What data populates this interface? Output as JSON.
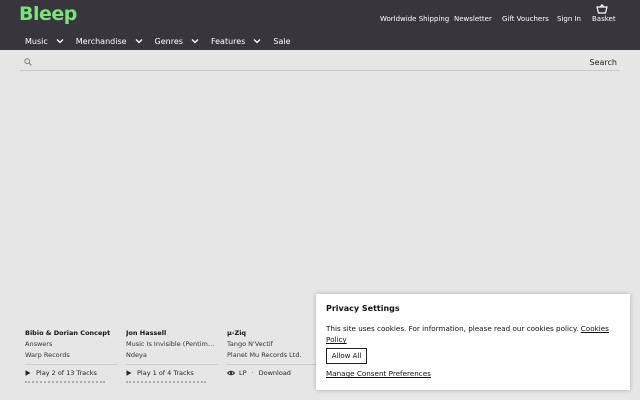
{
  "header": {
    "logo": "Bleep",
    "util_links": [
      "Worldwide Shipping",
      "Newsletter",
      "Gift Vouchers",
      "Sign In",
      "Basket"
    ],
    "nav": [
      {
        "label": "Music",
        "dropdown": true
      },
      {
        "label": "Merchandise",
        "dropdown": true
      },
      {
        "label": "Genres",
        "dropdown": true
      },
      {
        "label": "Features",
        "dropdown": true
      },
      {
        "label": "Sale",
        "dropdown": false
      }
    ]
  },
  "search": {
    "placeholder": "",
    "button": "Search"
  },
  "products": [
    {
      "artist": "Bibio & Dorian Concept",
      "title": "Answers",
      "label": "Warp Records",
      "action": "Play 2 of 13 Tracks",
      "icon": "play-icon"
    },
    {
      "artist": "Jon Hassell",
      "title": "Music Is Invisible (Pentimen...",
      "label": "Ndeya",
      "action": "Play 1 of 4 Tracks",
      "icon": "play-icon"
    },
    {
      "artist": "µ-Ziq",
      "title": "Tango N'Vectif",
      "label": "Planet Mu Records Ltd.",
      "format": "LP",
      "action": "Download",
      "icon": "eye-icon"
    }
  ],
  "consent": {
    "heading": "Privacy Settings",
    "text": "This site uses cookies. For information, please read our cookies policy.",
    "link": "Cookies Policy",
    "allow_button": "Allow All",
    "manage_link": "Manage Consent Preferences"
  },
  "colors": {
    "header_bg": "#38363c",
    "logo": "#7fe07f",
    "page_bg": "#e6e6e6"
  }
}
